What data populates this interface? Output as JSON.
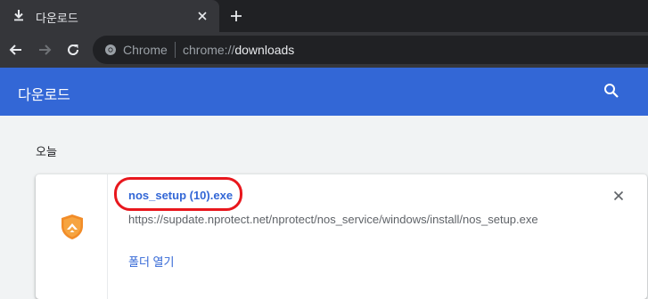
{
  "tab": {
    "title": "다운로드"
  },
  "omnibox": {
    "site": "Chrome",
    "url_scheme": "chrome://",
    "url_host": "downloads"
  },
  "header": {
    "title": "다운로드"
  },
  "downloads": {
    "date_label": "오늘",
    "item": {
      "file_name": "nos_setup (10).exe",
      "url": "https://supdate.nprotect.net/nprotect/nos_service/windows/install/nos_setup.exe",
      "show_folder": "폴더 열기"
    }
  },
  "colors": {
    "accent": "#3367d6",
    "highlight": "#e8171d",
    "icon_orange": "#f28c28"
  }
}
